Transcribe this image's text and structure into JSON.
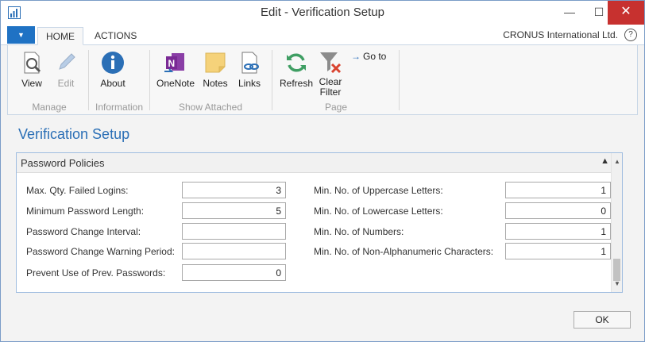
{
  "window": {
    "title": "Edit - Verification Setup"
  },
  "tabs": [
    {
      "label": "HOME",
      "active": true
    },
    {
      "label": "ACTIONS",
      "active": false
    }
  ],
  "company": "CRONUS International Ltd.",
  "help_icon": "?",
  "ribbon": {
    "groups": [
      {
        "label": "Manage"
      },
      {
        "label": "Information"
      },
      {
        "label": "Show Attached"
      },
      {
        "label": "Page"
      }
    ],
    "buttons": {
      "view": "View",
      "edit": "Edit",
      "about": "About",
      "onenote": "OneNote",
      "notes": "Notes",
      "links": "Links",
      "refresh": "Refresh",
      "clear_filter": "Clear Filter",
      "goto": "Go to"
    }
  },
  "page_title": "Verification Setup",
  "section": {
    "title": "Password Policies",
    "left_fields": [
      {
        "label": "Max. Qty. Failed Logins:",
        "value": "3"
      },
      {
        "label": "Minimum Password Length:",
        "value": "5"
      },
      {
        "label": "Password Change Interval:",
        "value": ""
      },
      {
        "label": "Password Change Warning Period:",
        "value": ""
      },
      {
        "label": "Prevent Use of Prev. Passwords:",
        "value": "0"
      }
    ],
    "right_fields": [
      {
        "label": "Min. No. of Uppercase Letters:",
        "value": "1"
      },
      {
        "label": "Min. No. of Lowercase Letters:",
        "value": "0"
      },
      {
        "label": "Min. No. of Numbers:",
        "value": "1"
      },
      {
        "label": "Min. No. of Non-Alphanumeric Characters:",
        "value": "1"
      }
    ]
  },
  "ok_button": "OK",
  "colors": {
    "accent": "#1f72c4",
    "title_blue": "#2b6fb6",
    "close_red": "#c7312f"
  }
}
